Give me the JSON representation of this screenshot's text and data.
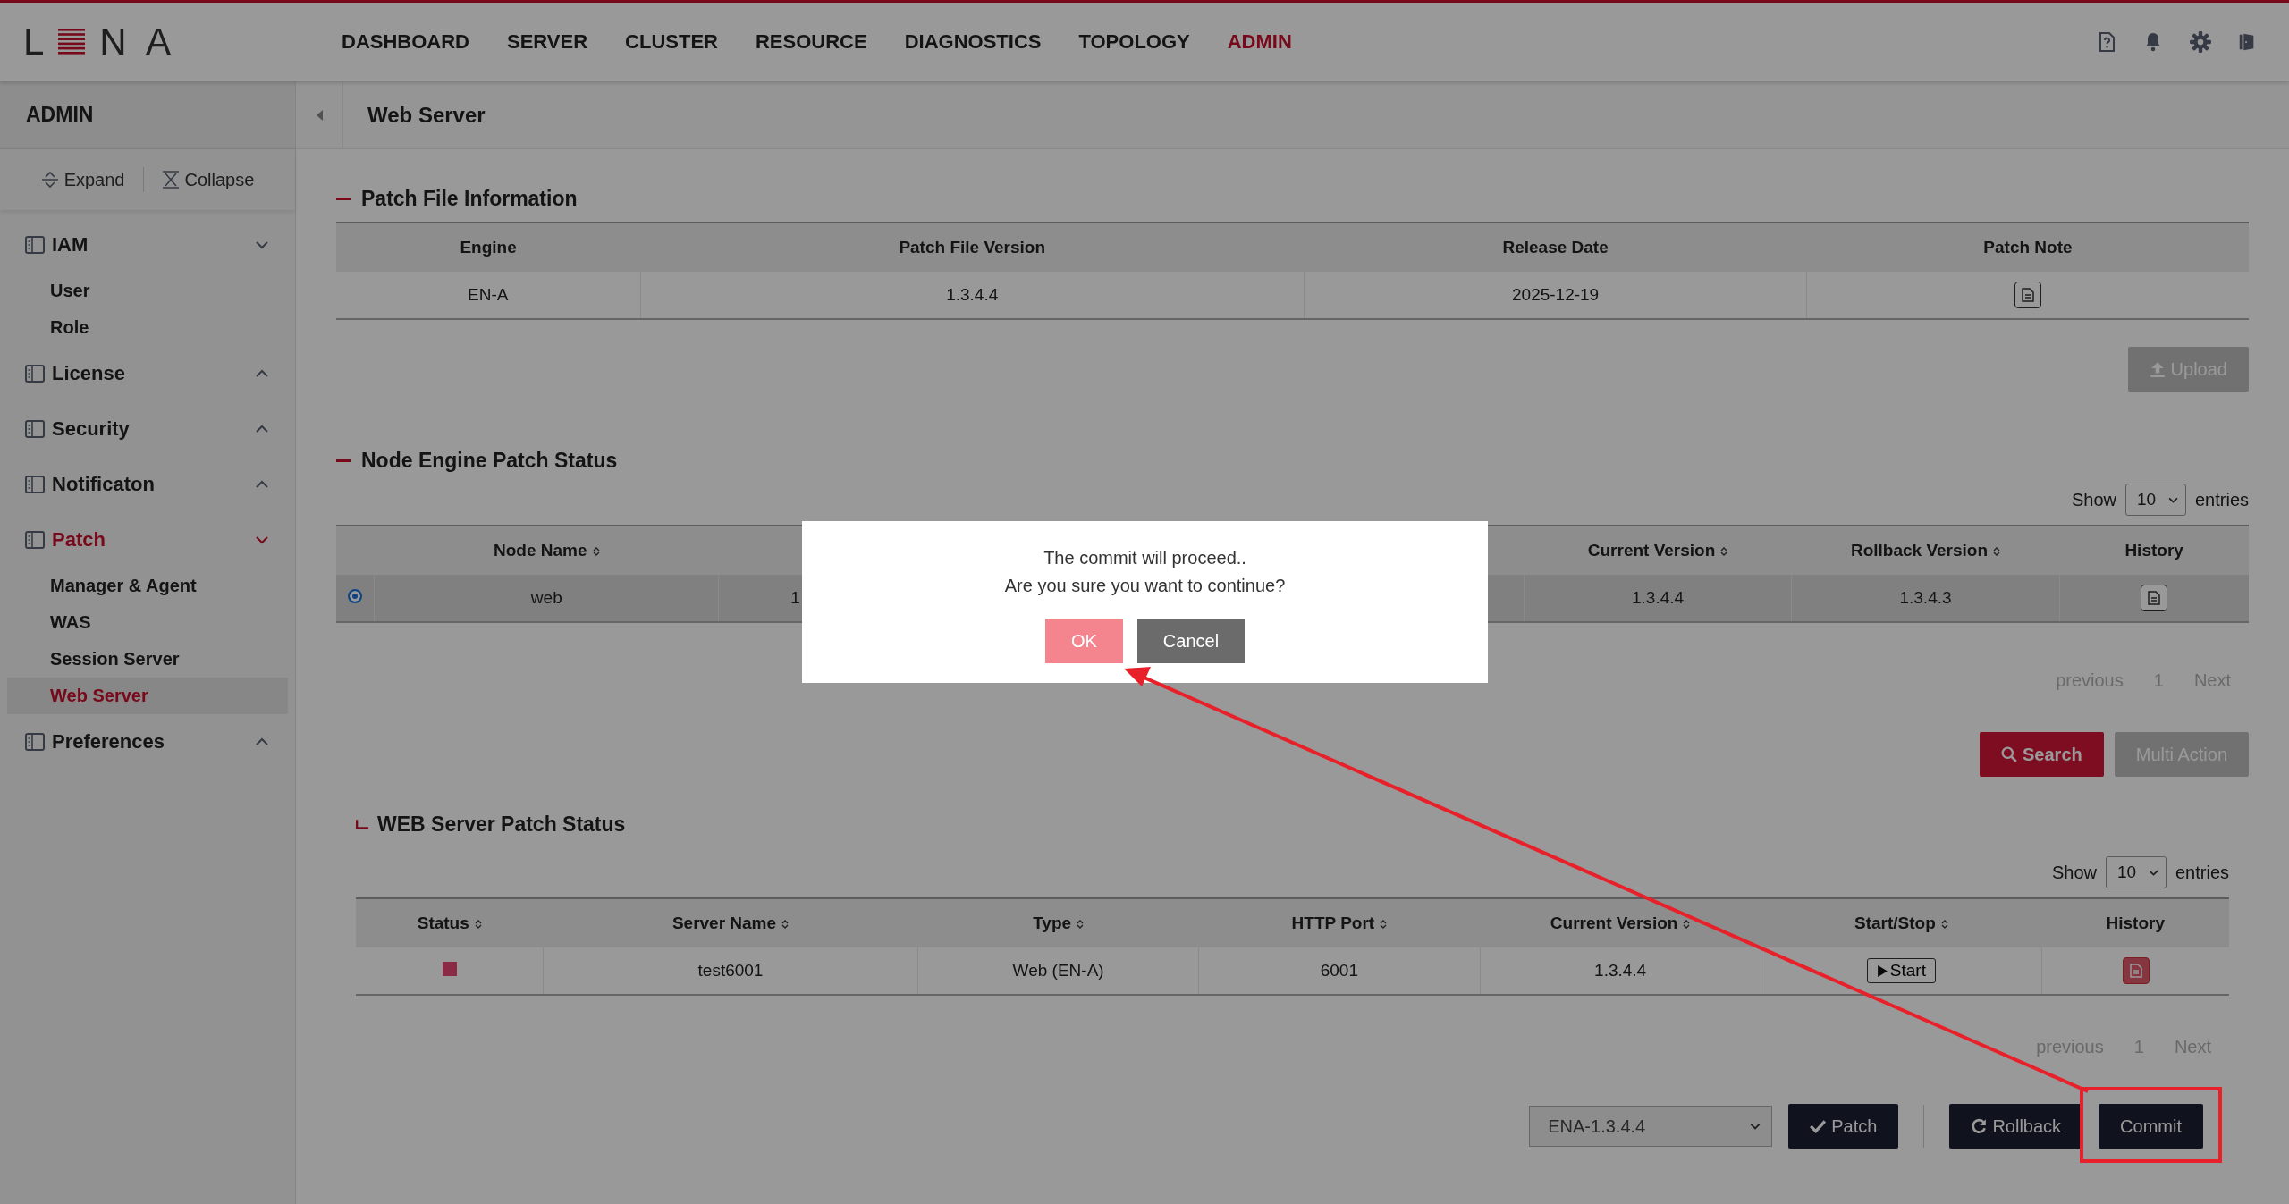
{
  "header": {
    "logo": {
      "left": "L",
      "right": "N A"
    },
    "nav": [
      {
        "label": "DASHBOARD",
        "selected": false
      },
      {
        "label": "SERVER",
        "selected": false
      },
      {
        "label": "CLUSTER",
        "selected": false
      },
      {
        "label": "RESOURCE",
        "selected": false
      },
      {
        "label": "DIAGNOSTICS",
        "selected": false
      },
      {
        "label": "TOPOLOGY",
        "selected": false
      },
      {
        "label": "ADMIN",
        "selected": true
      }
    ]
  },
  "sidebar": {
    "title": "ADMIN",
    "expand": "Expand",
    "collapse": "Collapse",
    "groups": [
      {
        "label": "IAM",
        "expanded": true,
        "selected": false,
        "children": [
          {
            "label": "User",
            "selected": false
          },
          {
            "label": "Role",
            "selected": false
          }
        ]
      },
      {
        "label": "License",
        "expanded": false,
        "selected": false
      },
      {
        "label": "Security",
        "expanded": false,
        "selected": false
      },
      {
        "label": "Notificaton",
        "expanded": false,
        "selected": false
      },
      {
        "label": "Patch",
        "expanded": true,
        "selected": true,
        "children": [
          {
            "label": "Manager & Agent",
            "selected": false
          },
          {
            "label": "WAS",
            "selected": false
          },
          {
            "label": "Session Server",
            "selected": false
          },
          {
            "label": "Web Server",
            "selected": true
          }
        ]
      },
      {
        "label": "Preferences",
        "expanded": false,
        "selected": false
      }
    ]
  },
  "page_title": "Web Server",
  "patch_file": {
    "title": "Patch File Information",
    "columns": [
      "Engine",
      "Patch File Version",
      "Release Date",
      "Patch Note"
    ],
    "rows": [
      {
        "engine": "EN-A",
        "version": "1.3.4.4",
        "release_date": "2025-12-19"
      }
    ],
    "upload": "Upload"
  },
  "node_status": {
    "title": "Node Engine Patch Status",
    "show_label": "Show",
    "page_size": "10",
    "entries_label": "entries",
    "columns": [
      {
        "label": "Node Name",
        "sortable": true
      },
      {
        "sortable": false
      },
      {
        "label": "Current Version",
        "sortable": true
      },
      {
        "label": "Rollback Version",
        "sortable": true
      },
      {
        "label": "History",
        "sortable": false
      }
    ],
    "rows": [
      {
        "selected": true,
        "cells": [
          "web",
          "1",
          "1.3.4.4",
          "1.3.4.3"
        ]
      }
    ],
    "pagination": {
      "previous": "previous",
      "page": "1",
      "next": "Next"
    },
    "search": "Search",
    "multi_action": "Multi Action"
  },
  "web_status": {
    "title": "WEB Server Patch Status",
    "show_label": "Show",
    "page_size": "10",
    "entries_label": "entries",
    "columns": [
      {
        "label": "Status",
        "sortable": true
      },
      {
        "label": "Server Name",
        "sortable": true
      },
      {
        "label": "Type",
        "sortable": true
      },
      {
        "label": "HTTP Port",
        "sortable": true
      },
      {
        "label": "Current Version",
        "sortable": true
      },
      {
        "label": "Start/Stop",
        "sortable": true
      },
      {
        "label": "History",
        "sortable": false
      }
    ],
    "rows": [
      {
        "color": "#8a2a45",
        "server_name": "test6001",
        "type": "Web (EN-A)",
        "http_port": "6001",
        "current_version": "1.3.4.4",
        "start": "Start"
      }
    ],
    "pagination": {
      "previous": "previous",
      "page": "1",
      "next": "Next"
    }
  },
  "actions": {
    "version": "ENA-1.3.4.4",
    "patch": "Patch",
    "rollback": "Rollback",
    "commit": "Commit"
  },
  "dialog": {
    "lines": [
      "The commit will proceed..",
      "Are you sure you want to continue?"
    ],
    "ok": "OK",
    "cancel": "Cancel"
  },
  "annotations": {
    "arrow": true,
    "highlight_box": true
  }
}
